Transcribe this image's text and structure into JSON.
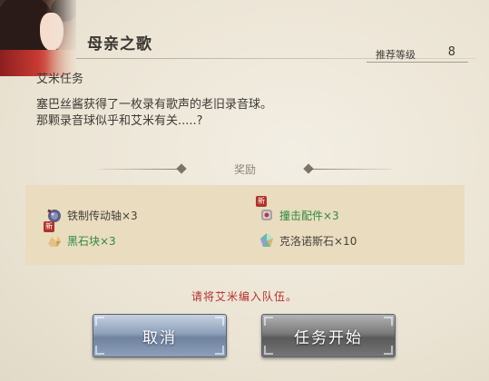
{
  "quest": {
    "title": "母亲之歌",
    "level_label": "推荐等级",
    "level_value": "8",
    "type": "艾米任务",
    "description_line1": "塞巴丝酱获得了一枚录有歌声的老旧录音球。",
    "description_line2": "那颗录音球似乎和艾米有关.....?"
  },
  "rewards": {
    "title": "奖励",
    "new_badge": "新",
    "items": [
      {
        "label": "铁制传动轴×3",
        "style": "normal",
        "icon": "gear-shaft-icon",
        "new": false
      },
      {
        "label": "撞击配件×3",
        "style": "green",
        "icon": "impact-part-icon",
        "new": true
      },
      {
        "label": "黑石块×3",
        "style": "green",
        "icon": "black-stone-icon",
        "new": true
      },
      {
        "label": "克洛诺斯石×10",
        "style": "normal",
        "icon": "chronos-stone-icon",
        "new": false
      }
    ]
  },
  "hint": "请将艾米编入队伍。",
  "buttons": {
    "cancel": "取消",
    "start": "任务开始"
  },
  "colors": {
    "background": "#ece6d8",
    "reward_panel": "#e9dcbf",
    "hint": "#b4312c",
    "green_text": "#2f8a3f"
  }
}
